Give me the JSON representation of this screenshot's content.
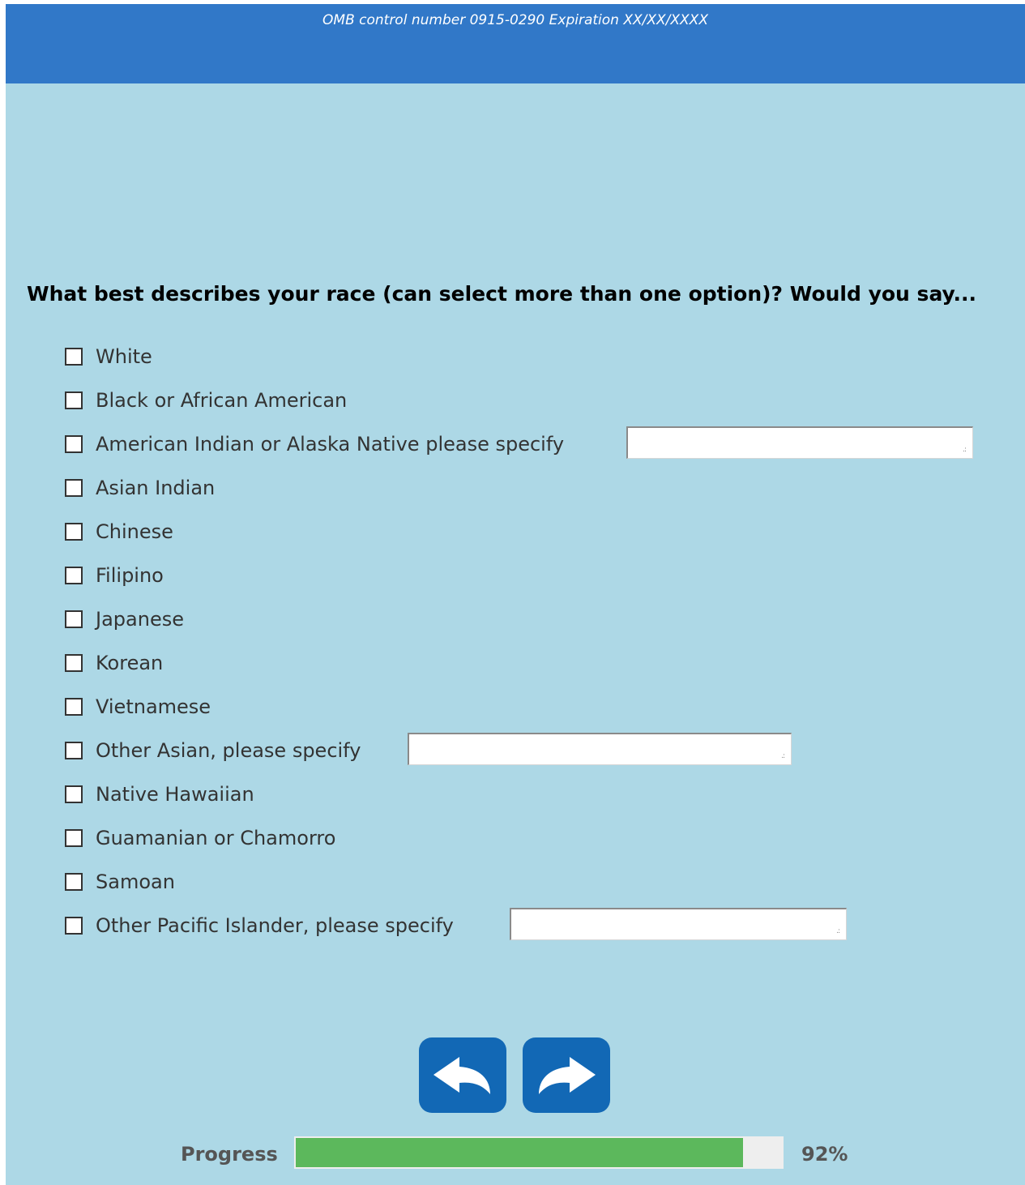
{
  "header": {
    "omb_text": "OMB control number 0915-0290 Expiration XX/XX/XXXX"
  },
  "question": "What best describes your race (can select more than one option)? Would you say...",
  "options": [
    {
      "label": "White",
      "checked": false
    },
    {
      "label": "Black or African American",
      "checked": false
    },
    {
      "label": "American Indian or Alaska Native please specify",
      "checked": false,
      "specify_value": ""
    },
    {
      "label": "Asian Indian",
      "checked": false
    },
    {
      "label": "Chinese",
      "checked": false
    },
    {
      "label": "Filipino",
      "checked": false
    },
    {
      "label": "Japanese",
      "checked": false
    },
    {
      "label": "Korean",
      "checked": false
    },
    {
      "label": "Vietnamese",
      "checked": false
    },
    {
      "label": "Other Asian, please specify",
      "checked": false,
      "specify_value": ""
    },
    {
      "label": "Native Hawaiian",
      "checked": false
    },
    {
      "label": "Guamanian or Chamorro",
      "checked": false
    },
    {
      "label": "Samoan",
      "checked": false
    },
    {
      "label": "Other Pacific Islander, please specify",
      "checked": false,
      "specify_value": ""
    }
  ],
  "nav": {
    "back_icon": "back-arrow-icon",
    "next_icon": "forward-arrow-icon"
  },
  "progress": {
    "label": "Progress",
    "percent": 92,
    "percent_text": "92%"
  },
  "colors": {
    "header": "#3178c8",
    "background": "#add8e6",
    "button": "#1268b5",
    "progress_fill": "#5cb85c"
  }
}
